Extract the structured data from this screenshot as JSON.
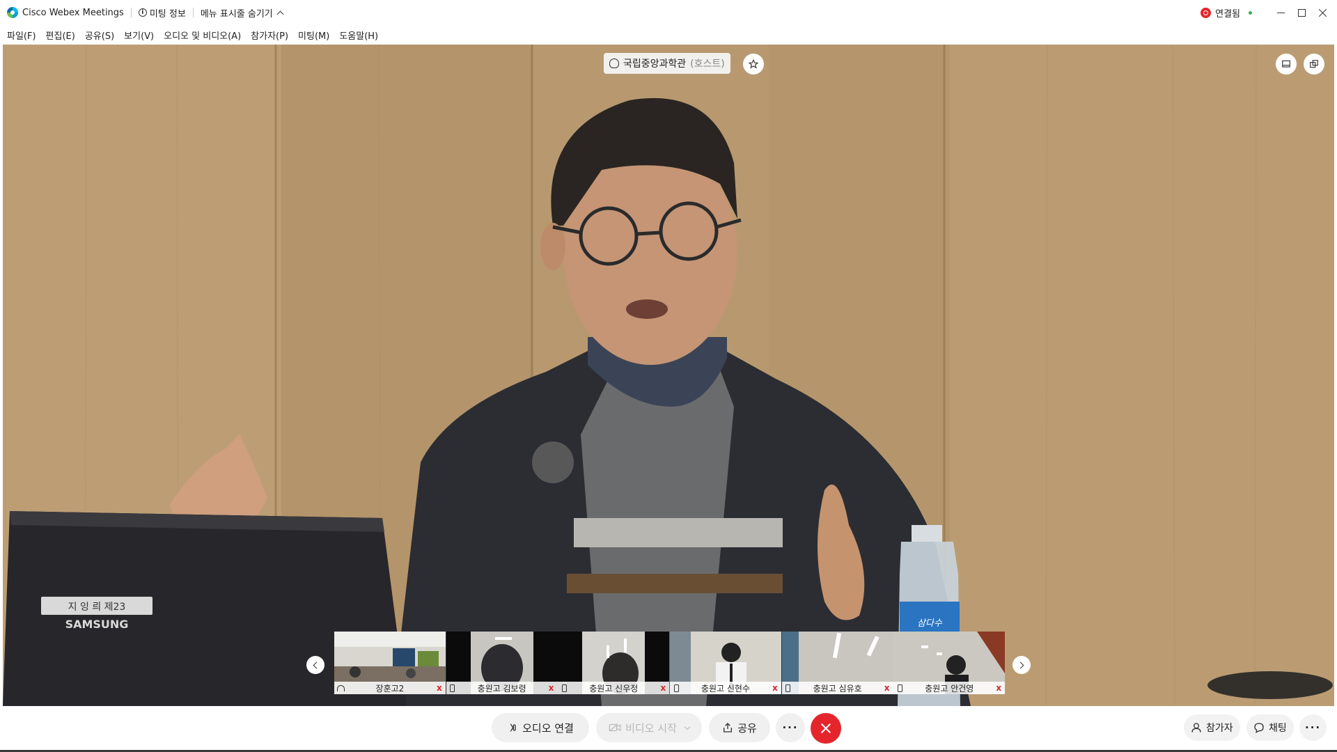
{
  "window": {
    "app_title": "Cisco Webex Meetings",
    "meeting_info": "미팅 정보",
    "hide_menu": "메뉴 표시줄 숨기기",
    "status": "연결됨"
  },
  "menu": [
    "파일(F)",
    "편집(E)",
    "공유(S)",
    "보기(V)",
    "오디오 및 비디오(A)",
    "참가자(P)",
    "미팅(M)",
    "도움말(H)"
  ],
  "stage": {
    "host_name": "국립중앙과학관",
    "host_role": "(호스트)",
    "laptop_label": "지 잉 릐 제23",
    "laptop_brand": "SAMSUNG",
    "bottle_label": "삼다수"
  },
  "participants": [
    {
      "name": "장훈고2",
      "device": "headset-icon"
    },
    {
      "name": "충원고 김보령",
      "device": "phone-icon"
    },
    {
      "name": "충원고 신우정",
      "device": "phone-icon"
    },
    {
      "name": "충원고 신현수",
      "device": "phone-icon"
    },
    {
      "name": "충원고 심유호",
      "device": "phone-icon"
    },
    {
      "name": "충원고 안건영",
      "device": "phone-icon"
    }
  ],
  "controls": {
    "audio": "오디오 연결",
    "video": "비디오 시작",
    "share": "공유",
    "more": "···",
    "participants": "참가자",
    "chat": "채팅",
    "panel_more": "···"
  },
  "colors": {
    "end_call": "#e4262c",
    "mute": "#d8262c",
    "connected_dot": "#2fb34a",
    "wall": "#b39369"
  }
}
